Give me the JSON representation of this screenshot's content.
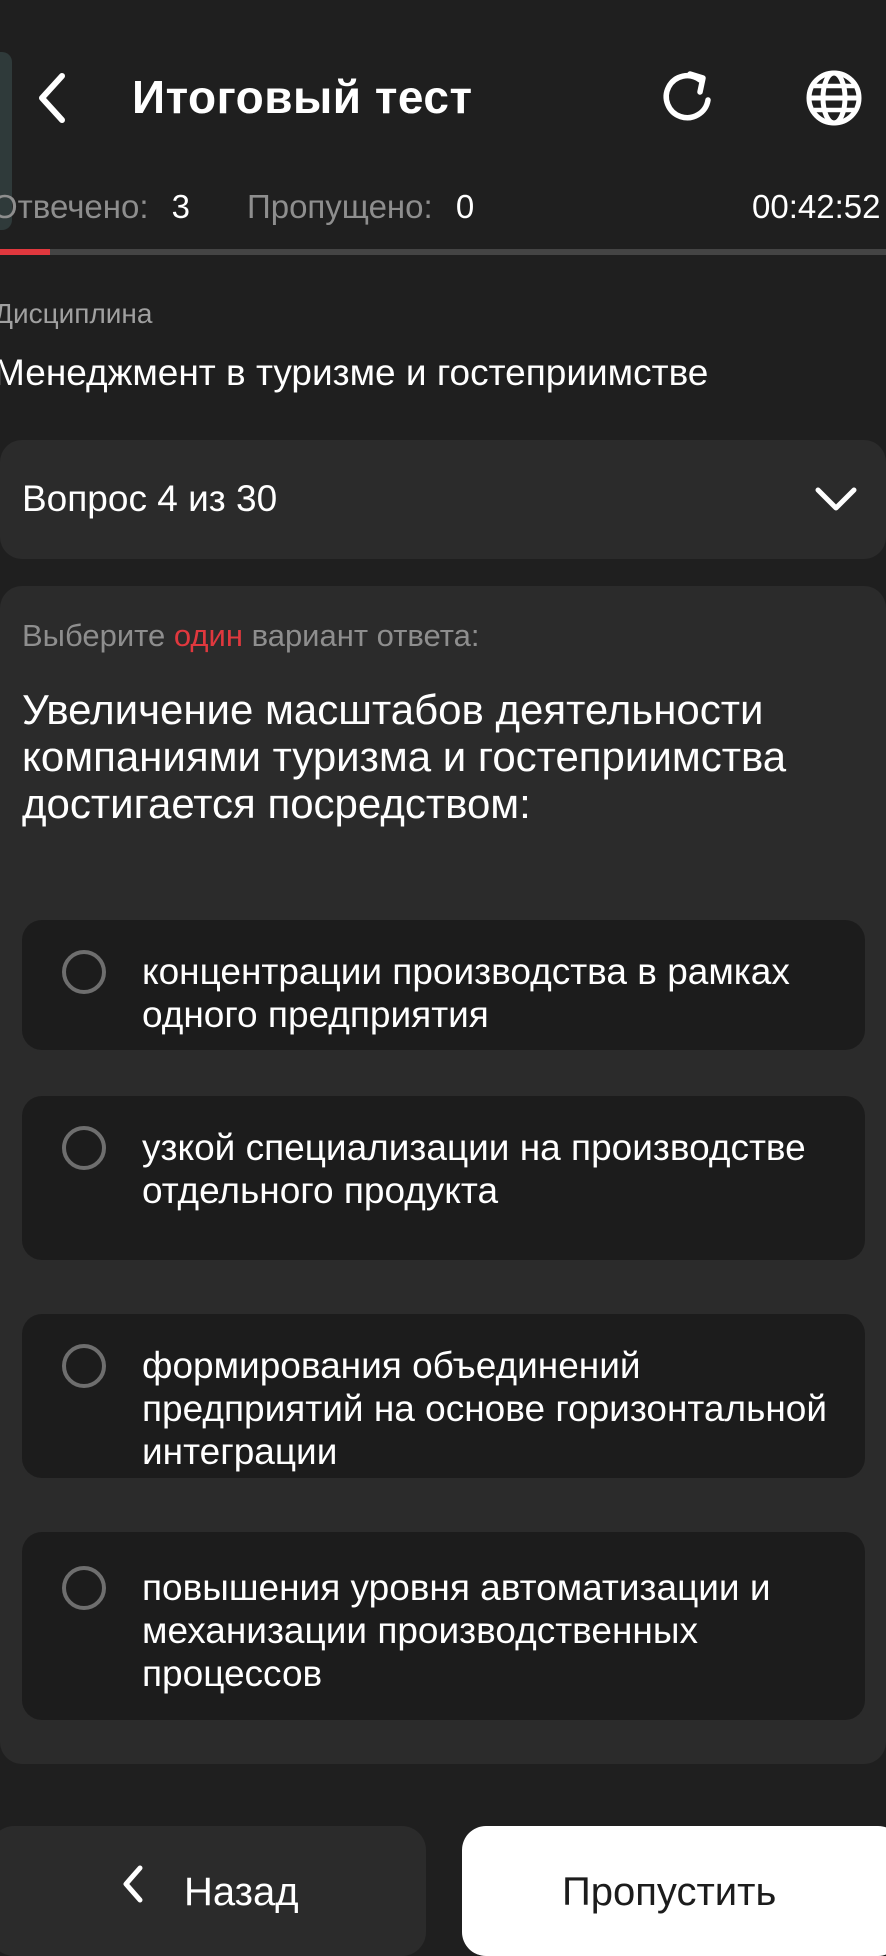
{
  "header": {
    "title": "Итоговый тест",
    "back_icon": "chevron-left-icon",
    "refresh_icon": "refresh-icon",
    "language_icon": "globe-icon"
  },
  "stats": {
    "answered_label": "Отвечено:",
    "answered_value": "3",
    "skipped_label": "Пропущено:",
    "skipped_value": "0",
    "timer": "00:42:52",
    "progress_fraction": 0.0567
  },
  "discipline": {
    "label": "Дисциплина",
    "value": "Менеджмент в туризме и гостеприимстве"
  },
  "question_selector": {
    "text": "Вопрос 4 из 30",
    "icon": "chevron-down-icon"
  },
  "question": {
    "instruction_before": "Выберите ",
    "instruction_accent": "один",
    "instruction_after": " вариант ответа:",
    "text": "Увеличение масштабов деятельности компаниями туризма и гостеприимства достигается посредством:",
    "options": [
      {
        "label": "концентрации производства в рамках одного предприятия",
        "selected": false
      },
      {
        "label": "узкой специализации на производстве отдельного продукта",
        "selected": false
      },
      {
        "label": "формирования объединений предприятий на основе горизонтальной интеграции",
        "selected": false
      },
      {
        "label": "повышения уровня автоматизации и механизации производственных процессов",
        "selected": false
      }
    ]
  },
  "footer": {
    "back_label": "Назад",
    "skip_label": "Пропустить"
  },
  "colors": {
    "background": "#1f1f1f",
    "surface": "#2b2b2b",
    "option_bg": "#1c1c1c",
    "accent": "#e0383e",
    "muted_text": "#8e8e8e"
  }
}
